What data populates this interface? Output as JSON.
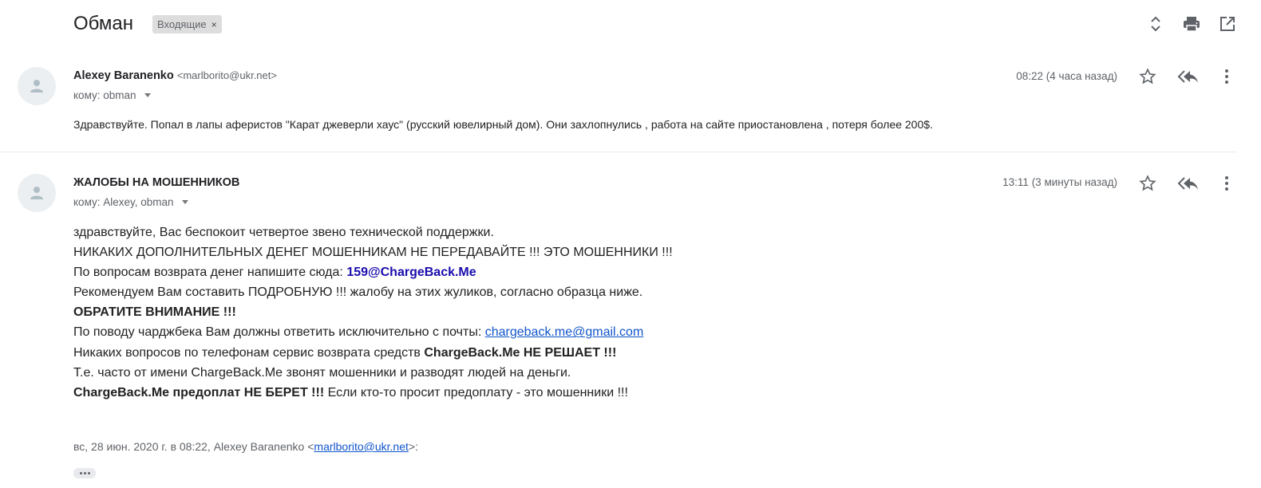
{
  "thread": {
    "subject": "Обман",
    "label": "Входящие",
    "label_remove": "×"
  },
  "toolbar_icons": [
    "expand-collapse-icon",
    "print-icon",
    "open-new-window-icon"
  ],
  "messages": [
    {
      "sender_name": "Alexey Baranenko",
      "sender_email": "<marlborito@ukr.net>",
      "to": "кому: obman",
      "time": "08:22 (4 часа назад)",
      "snippet": "Здравствуйте. Попал в лапы аферистов \"Карат джеверли хаус\" (русский ювелирный дом). Они захлопнулись , работа на сайте приостановлена , потеря более 200$."
    },
    {
      "sender_name": "ЖАЛОБЫ НА МОШЕННИКОВ",
      "to": "кому: Alexey, obman",
      "time": "13:11 (3 минуты назад)",
      "body": {
        "line1": "здравствуйте, Вас беспокоит четвертое звено технической поддержки.",
        "line2": "НИКАКИХ ДОПОЛНИТЕЛЬНЫХ ДЕНЕГ МОШЕННИКАМ НЕ ПЕРЕДАВАЙТЕ !!! ЭТО МОШЕННИКИ !!!",
        "line3_text": "По вопросам возврата денег напишите сюда: ",
        "line3_email": "159@ChargeBack.Me",
        "line4": "Рекомендуем Вам составить ПОДРОБНУЮ !!! жалобу на этих жуликов, согласно образца ниже.",
        "line5": "ОБРАТИТЕ ВНИМАНИЕ !!!",
        "line6_text": "По поводу чарджбека Вам должны ответить исключительно с почты: ",
        "line6_link": "chargeback.me@gmail.com",
        "line7_text": "Никаких вопросов по телефонам сервис возврата средств ",
        "line7_bold": "ChargeBack.Me НЕ РЕШАЕТ !!!",
        "line8": "Т.е. часто от имени ChargeBack.Me звонят мошенники и разводят людей на деньги.",
        "line9_bold": "ChargeBack.Me предоплат НЕ БЕРЕТ !!!",
        "line9_text": " Если кто-то просит предоплату - это мошенники !!!"
      },
      "quote": {
        "prefix": "вс, 28 июн. 2020 г. в 08:22, Alexey Baranenko <",
        "link": "marlborito@ukr.net",
        "suffix": ">:"
      }
    }
  ]
}
